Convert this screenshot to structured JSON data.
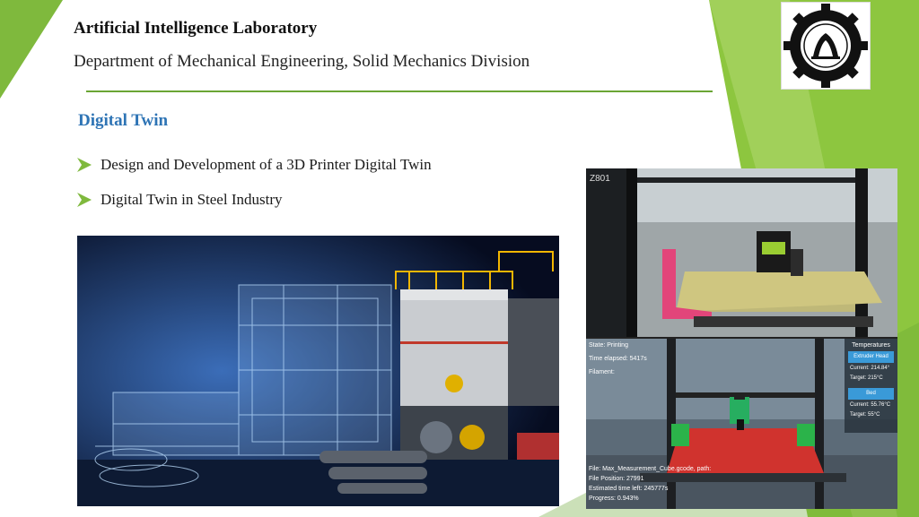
{
  "header": {
    "lab_title": "Artificial Intelligence Laboratory",
    "department": "Department of Mechanical Engineering, Solid Mechanics Division"
  },
  "section_title": "Digital Twin",
  "bullets": [
    {
      "label": "Design and Development of a 3D Printer Digital Twin"
    },
    {
      "label": "Digital Twin in Steel Industry"
    }
  ],
  "printer_hud": {
    "state": "State: Printing",
    "time_elapsed": "Time elapsed: 5417s",
    "filament": "Filament:",
    "file": "File: Max_Measurement_Cube.gcode, path:",
    "file_position": "File Position: 27991",
    "estimated_time": "Estimated time left: 245777s",
    "progress": "Progress: 0.943%"
  },
  "temperatures": {
    "title": "Temperatures",
    "extruder_button": "Extruder Head",
    "extruder_current": "Current:  214.84°",
    "extruder_target": "Target:      215°C",
    "bed_button": "Bed",
    "bed_current": "Current:  55.76°C",
    "bed_target": "Target:      55°C"
  },
  "colors": {
    "accent_green": "#6aa534",
    "section_blue": "#2e74b5",
    "hud_button_blue": "#3a9ad8"
  }
}
